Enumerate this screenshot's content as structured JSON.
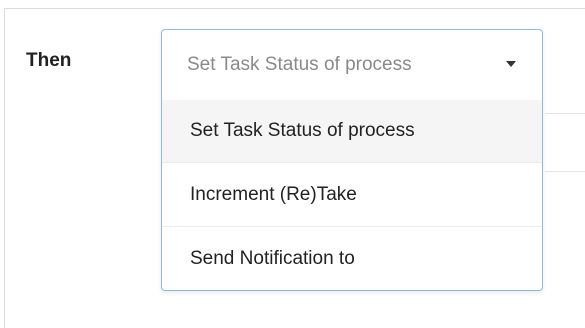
{
  "rule": {
    "then_label": "Then"
  },
  "action_select": {
    "selected_value": "Set Task Status of process",
    "options": [
      {
        "label": "Set Task Status of process"
      },
      {
        "label": "Increment (Re)Take"
      },
      {
        "label": "Send Notification to"
      }
    ],
    "caret_icon": "caret-down-icon"
  }
}
